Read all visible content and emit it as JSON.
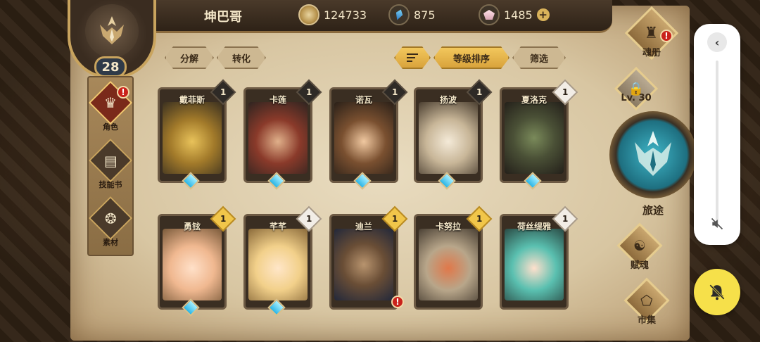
{
  "header": {
    "username": "坤巴哥",
    "coins": "124733",
    "crystals": "875",
    "gems": "1485",
    "add_icon": "plus-icon"
  },
  "player": {
    "level": "28",
    "emblem_icon": "emblem-crest-icon"
  },
  "left_nav": {
    "items": [
      {
        "label": "角色",
        "icon": "character-icon",
        "alert": "!"
      },
      {
        "label": "技能书",
        "icon": "skill-book-icon"
      },
      {
        "label": "素材",
        "icon": "material-icon"
      }
    ]
  },
  "toolbar": {
    "decompose_label": "分解",
    "convert_label": "转化",
    "sort_label": "等级排序",
    "filter_label": "筛选"
  },
  "cards": [
    {
      "name": "戴菲斯",
      "rank": "1",
      "tier": "dark"
    },
    {
      "name": "卡莲",
      "rank": "1",
      "tier": "dark"
    },
    {
      "name": "诺瓦",
      "rank": "1",
      "tier": "dark"
    },
    {
      "name": "扬波",
      "rank": "1",
      "tier": "dark"
    },
    {
      "name": "夏洛克",
      "rank": "1",
      "tier": "silver"
    },
    {
      "name": "勇铉",
      "rank": "1",
      "tier": "gold"
    },
    {
      "name": "芊芊",
      "rank": "1",
      "tier": "silver"
    },
    {
      "name": "迪兰",
      "rank": "1",
      "tier": "gold",
      "alert": "!"
    },
    {
      "name": "卡努拉",
      "rank": "1",
      "tier": "gold"
    },
    {
      "name": "荷丝缇雅",
      "rank": "1",
      "tier": "silver"
    }
  ],
  "right_nav": {
    "soul_book_label": "魂册",
    "soul_book_alert": "!",
    "lock_level": "Lv. 30",
    "journey_label": "旅途",
    "talent_label": "赋魂",
    "market_label": "市集"
  },
  "overlay": {
    "back_icon": "chevron-left-icon",
    "mute_icon": "mute-icon",
    "bell_icon": "bell-off-icon"
  }
}
